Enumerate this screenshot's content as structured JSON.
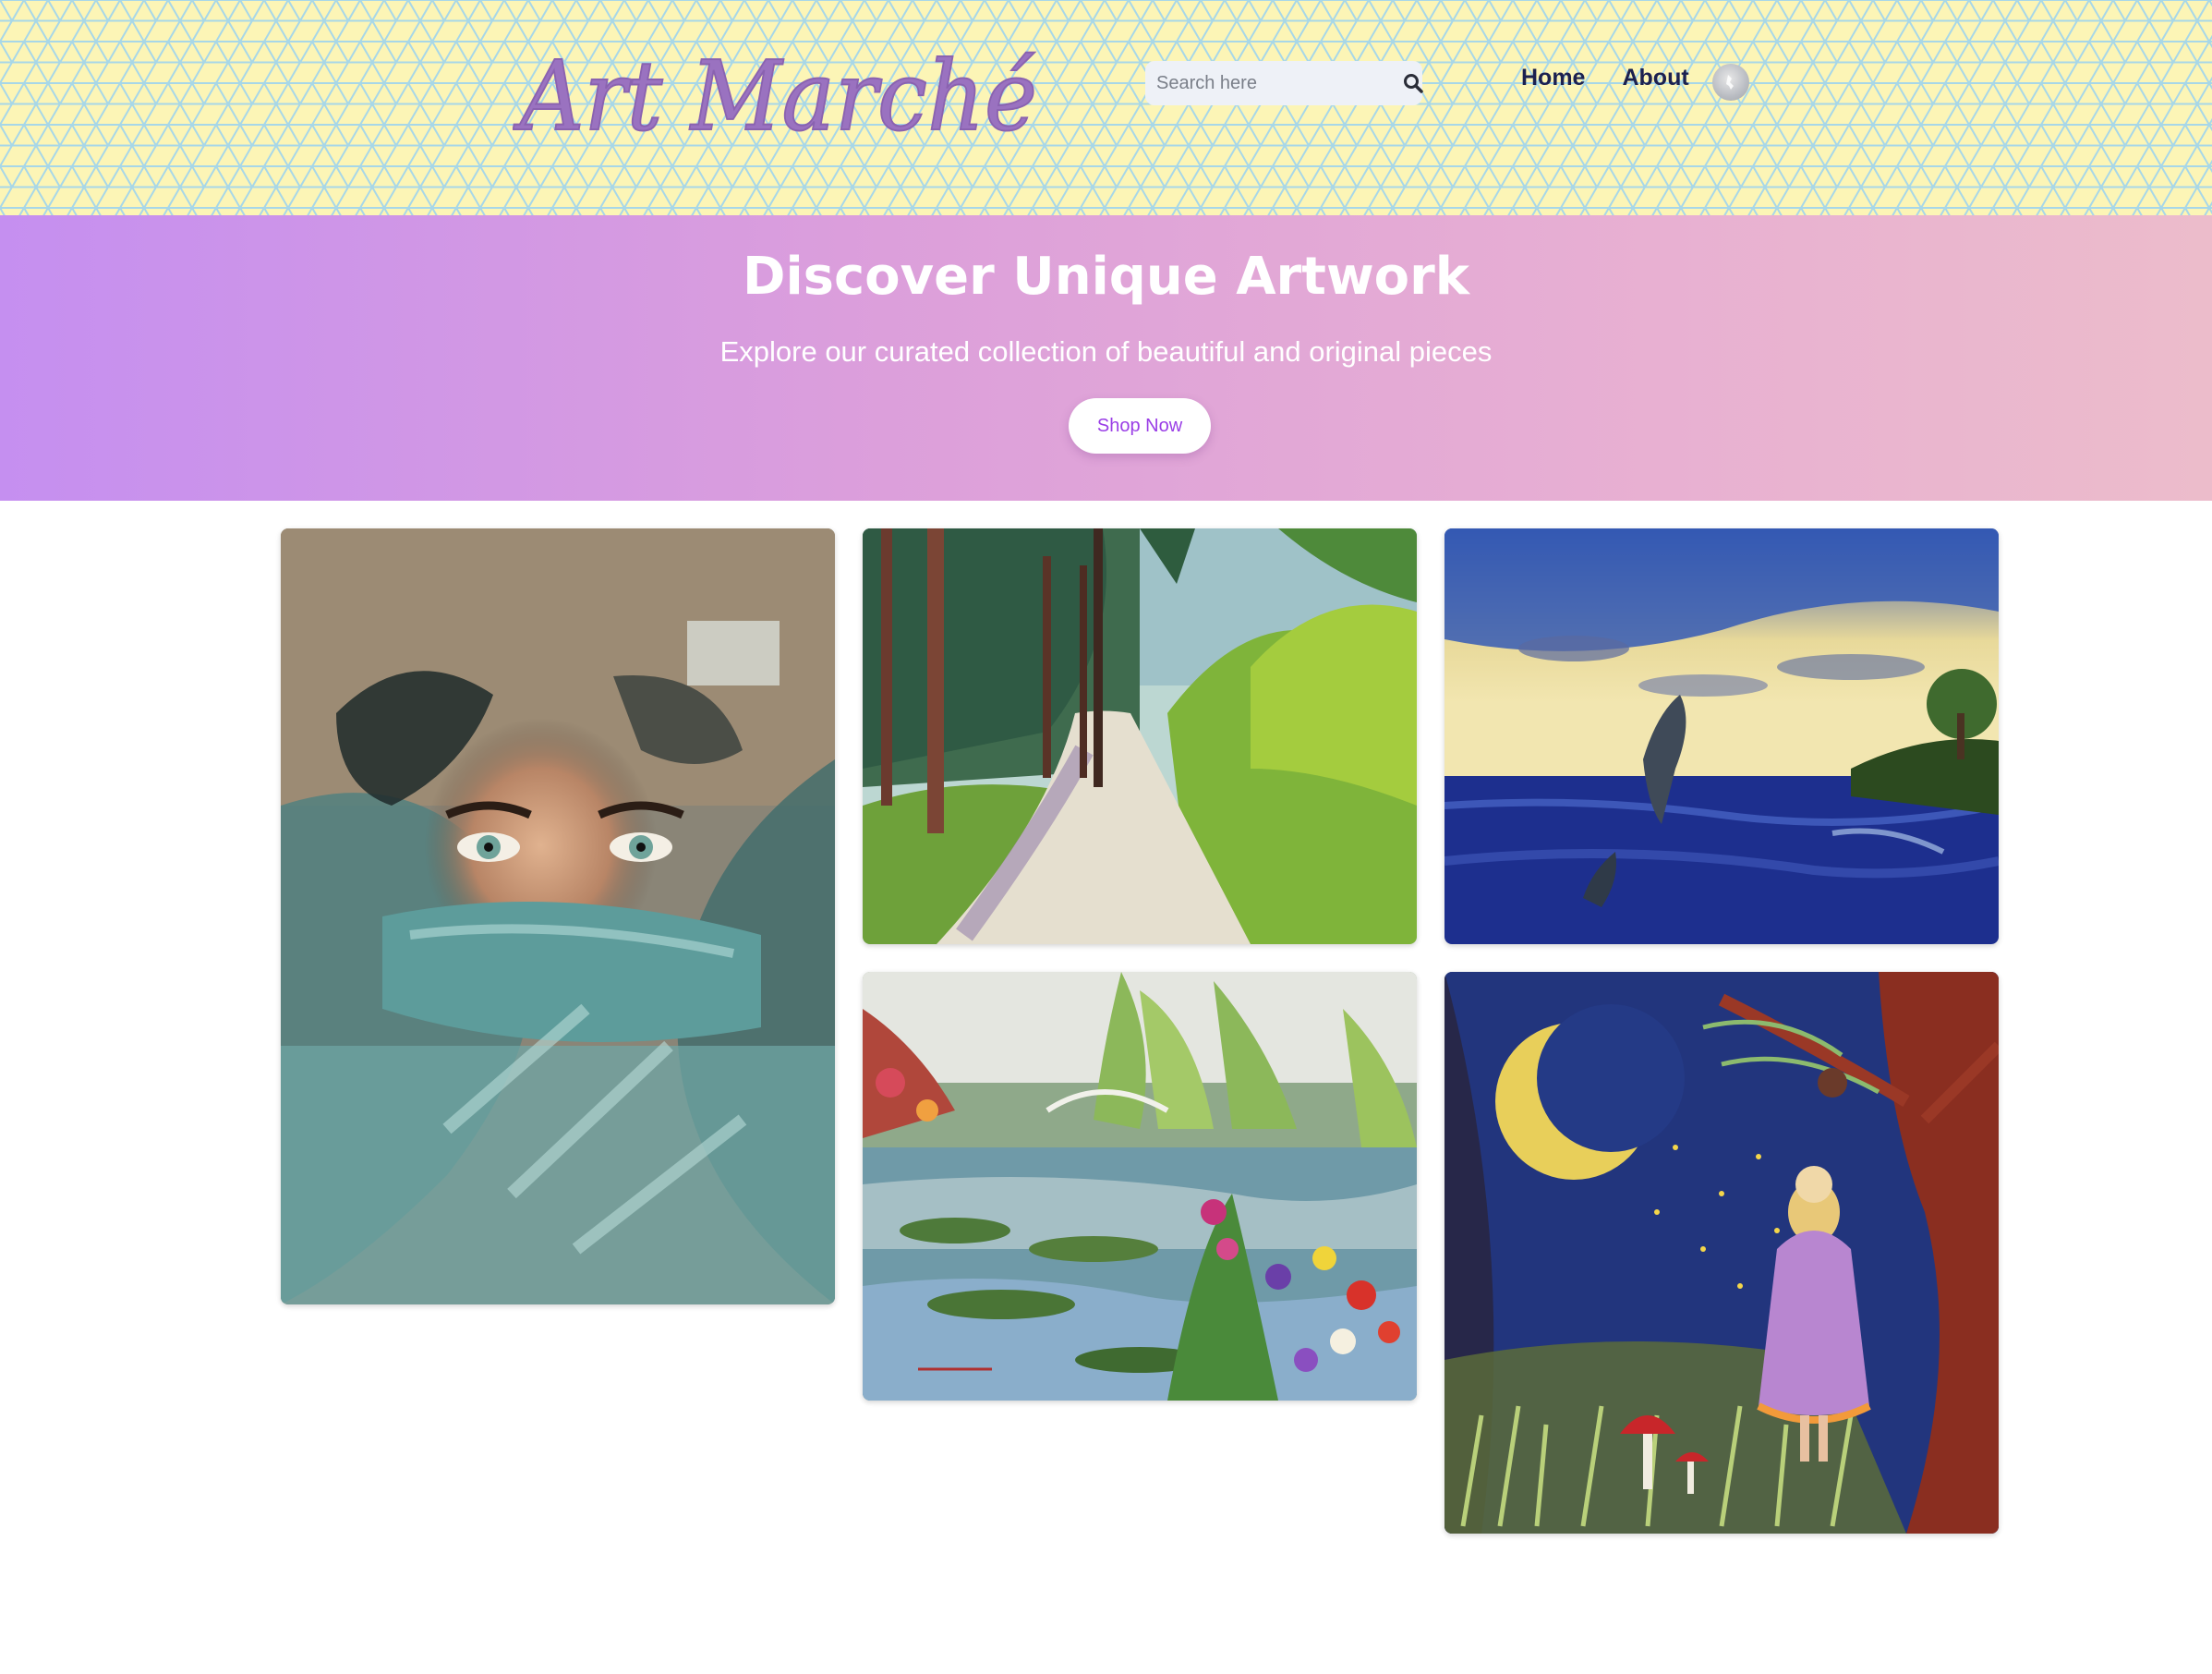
{
  "header": {
    "logo_text": "Art Marché",
    "search": {
      "placeholder": "Search here",
      "value": ""
    },
    "nav": [
      {
        "label": "Home"
      },
      {
        "label": "About"
      }
    ],
    "icons": {
      "search": "search-icon",
      "avatar": "user-avatar-icon"
    },
    "colors": {
      "background": "#fcf5b6",
      "pattern_lines": "#a7d7e8",
      "logo": "#9a72c0",
      "nav_text": "#1c2150"
    }
  },
  "hero": {
    "title": "Discover Unique Artwork",
    "subtitle": "Explore our curated collection of beautiful and original pieces",
    "button_label": "Shop Now",
    "colors": {
      "gradient_start": "#c58ff0",
      "gradient_end": "#ecbccb",
      "button_text": "#9a3ee6"
    }
  },
  "gallery": {
    "items": [
      {
        "subject": "portrait-woman-teal-abstract"
      },
      {
        "subject": "forest-path-landscape"
      },
      {
        "subject": "dolphins-ocean-sunset"
      },
      {
        "subject": "water-lily-pond-garden"
      },
      {
        "subject": "girl-moon-night-tree"
      }
    ]
  }
}
